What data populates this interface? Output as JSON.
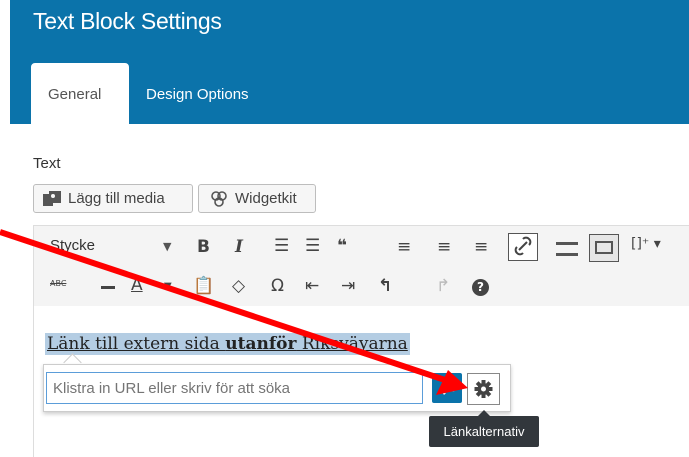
{
  "header": {
    "title": "Text Block Settings"
  },
  "tabs": [
    {
      "label": "General",
      "active": true
    },
    {
      "label": "Design Options",
      "active": false
    }
  ],
  "field": {
    "label": "Text"
  },
  "media_buttons": {
    "add_media": "Lägg till media",
    "widgetkit": "Widgetkit"
  },
  "toolbar": {
    "format_select": "Stycke",
    "row1": [
      "bold-icon",
      "italic-icon",
      "bullet-list-icon",
      "numbered-list-icon",
      "blockquote-icon",
      "align-left-icon",
      "align-center-icon",
      "align-right-icon",
      "link-icon",
      "read-more-icon",
      "toolbar-toggle-icon",
      "shortcode-icon"
    ],
    "row2": [
      "strikethrough-icon",
      "horizontal-rule-icon",
      "text-color-icon",
      "paste-text-icon",
      "clear-format-icon",
      "special-char-icon",
      "outdent-icon",
      "indent-icon",
      "undo-icon",
      "redo-icon",
      "help-icon"
    ],
    "text_color_letter": "A",
    "strikethrough_text": "ABC"
  },
  "editor": {
    "link_text_before": "Länk till extern sida ",
    "link_text_bold": "utanför",
    "link_text_after": " Riksväyarna"
  },
  "link_popup": {
    "placeholder": "Klistra in URL eller skriv för att söka",
    "tooltip": "Länkalternativ"
  },
  "colors": {
    "header": "#0b73aa",
    "annotation_arrow": "#ff0000"
  }
}
